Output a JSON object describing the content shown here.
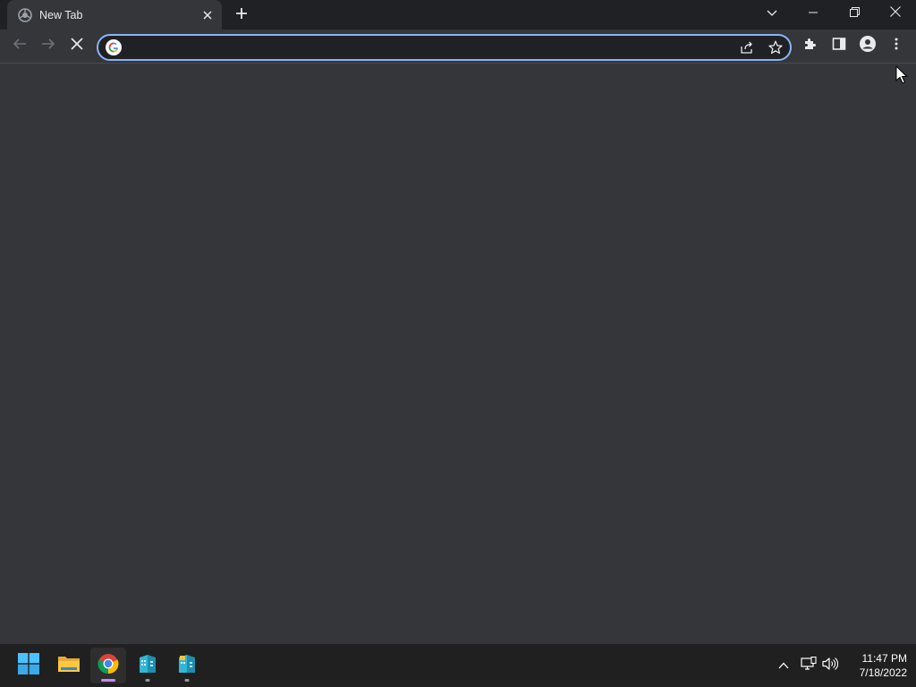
{
  "browser": {
    "tab": {
      "title": "New Tab"
    },
    "omnibox": {
      "value": "",
      "placeholder": ""
    },
    "icons": {
      "favicon": "chrome-newtab-icon",
      "tab_close": "close-icon",
      "new_tab": "plus-icon",
      "tab_search": "chevron-down-icon",
      "minimize": "minimize-icon",
      "restore": "restore-icon",
      "close_window": "close-icon",
      "back": "arrow-left-icon",
      "forward": "arrow-right-icon",
      "stop": "close-icon",
      "google": "google-icon",
      "share": "share-icon",
      "bookmark": "star-icon",
      "extensions": "puzzle-icon",
      "side_panel": "side-panel-icon",
      "profile": "person-icon",
      "menu": "kebab-menu-icon"
    }
  },
  "taskbar": {
    "apps": [
      {
        "name": "Start",
        "icon": "windows-start-icon"
      },
      {
        "name": "File Explorer",
        "icon": "folder-icon"
      },
      {
        "name": "Google Chrome",
        "icon": "chrome-icon",
        "active": true
      },
      {
        "name": "App",
        "icon": "building-icon"
      },
      {
        "name": "App",
        "icon": "building-icon"
      }
    ],
    "tray": {
      "icons": [
        "chevron-up-icon",
        "network-icon",
        "volume-icon"
      ],
      "time": "11:47 PM",
      "date": "7/18/2022"
    }
  },
  "colors": {
    "accent": "#8ab4f8",
    "toolbar_bg": "#35363a",
    "tabstrip_bg": "#202124",
    "taskbar_bg": "#202020",
    "active_indicator": "#c58af9"
  }
}
